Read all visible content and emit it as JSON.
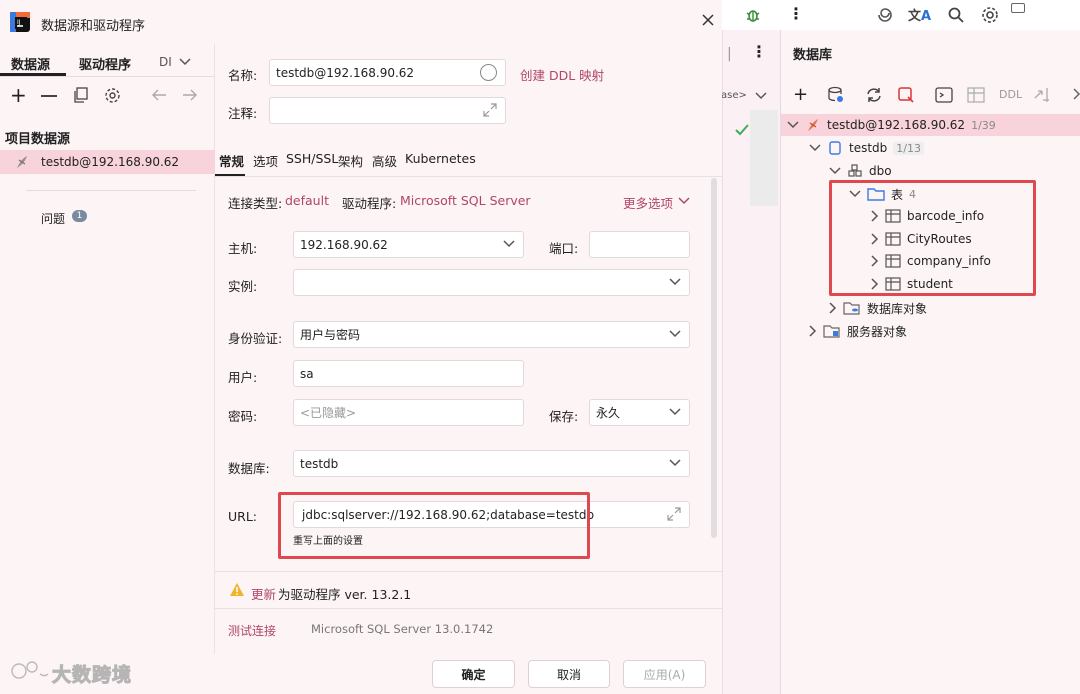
{
  "dialog": {
    "title": "数据源和驱动程序",
    "left": {
      "tabs": [
        "数据源",
        "驱动程序",
        "DI"
      ],
      "section_title": "项目数据源",
      "datasource_item": "testdb@192.168.90.62",
      "problems_label": "问题",
      "problems_count": "1"
    },
    "form": {
      "name_label": "名称:",
      "name_value": "testdb@192.168.90.62",
      "create_ddl_link": "创建 DDL 映射",
      "comment_label": "注释:",
      "tabs": [
        "常规",
        "选项",
        "SSH/SSL",
        "架构",
        "高级",
        "Kubernetes"
      ],
      "conn_type_label": "连接类型:",
      "conn_type_value": "default",
      "driver_label": "驱动程序:",
      "driver_value": "Microsoft SQL Server",
      "more_options": "更多选项",
      "host_label": "主机:",
      "host_value": "192.168.90.62",
      "port_label": "端口:",
      "instance_label": "实例:",
      "auth_label": "身份验证:",
      "auth_value": "用户与密码",
      "user_label": "用户:",
      "user_value": "sa",
      "password_label": "密码:",
      "password_placeholder": "<已隐藏>",
      "save_label": "保存:",
      "save_value": "永久",
      "database_label": "数据库:",
      "database_value": "testdb",
      "url_label": "URL:",
      "url_value": "jdbc:sqlserver://192.168.90.62;database=testdb",
      "override_note": "重写上面的设置",
      "update_link": "更新",
      "update_text": "为驱动程序 ver. 13.2.1",
      "test_connection": "测试连接",
      "server_version": "Microsoft SQL Server 13.0.1742"
    },
    "buttons": {
      "ok": "确定",
      "cancel": "取消",
      "apply": "应用(A)"
    },
    "watermark": "大数跨境"
  },
  "ide": {
    "tab_fragment": "ase>"
  },
  "database_panel": {
    "title": "数据库",
    "toolbar_ddl": "DDL",
    "tree": {
      "datasource": "testdb@192.168.90.62",
      "datasource_count": "1/39",
      "database": "testdb",
      "database_count": "1/13",
      "schema": "dbo",
      "tables_folder": "表",
      "tables_count": "4",
      "tables": [
        "barcode_info",
        "CityRoutes",
        "company_info",
        "student"
      ],
      "db_objects": "数据库对象",
      "server_objects": "服务器对象"
    }
  },
  "colors": {
    "accent_link": "#b0466a",
    "highlight_box": "#e0484f",
    "selection": "#f8d3dc",
    "ok_check": "#3fae5a"
  }
}
